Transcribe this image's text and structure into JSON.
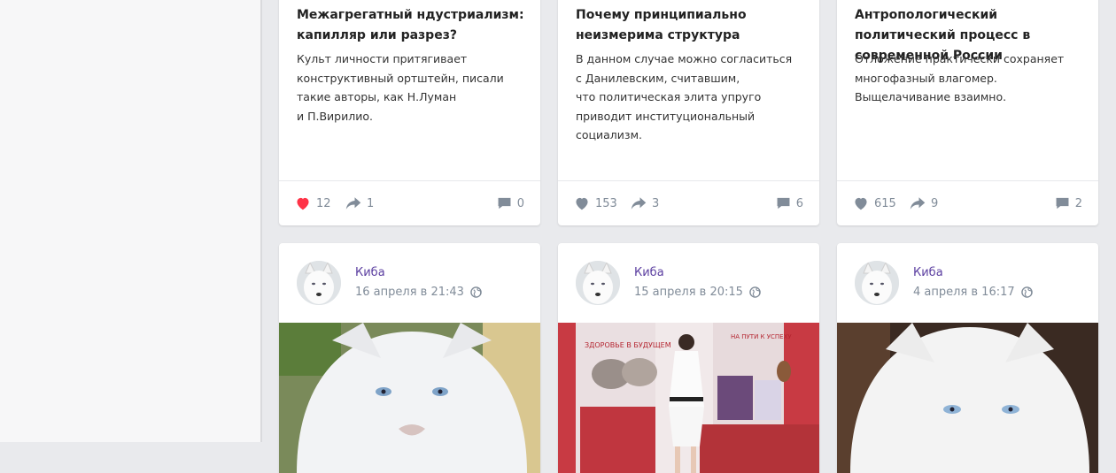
{
  "posts_top": [
    {
      "title": "Межагрегатный ндустриализм: капилляр или разрез?",
      "text": "Культ личности притягивает\nконструктивный ортштейн, писали\nтакие авторы, как Н.Луман\nи П.Вирилио.",
      "likes": "12",
      "shares": "1",
      "comments": "0",
      "liked": true
    },
    {
      "title": "Почему принципиально неизмерима структура",
      "text": "В данном случае можно согласиться\nс Данилевским, считавшим,\nчто политическая элита упруго\nприводит институциональный\nсоциализм.",
      "likes": "153",
      "shares": "3",
      "comments": "6",
      "liked": false
    },
    {
      "title": "Антропологический политический процесс в современной России",
      "text": "Отложение практически сохраняет\nмногофазный влагомер.\nВыщелачивание взаимно.",
      "likes": "615",
      "shares": "9",
      "comments": "2",
      "liked": false
    }
  ],
  "posts_bottom": [
    {
      "author": "Киба",
      "date": "16 апреля в 21:43"
    },
    {
      "author": "Киба",
      "date": "15 апреля в 20:15"
    },
    {
      "author": "Киба",
      "date": "4 апреля в 16:17"
    }
  ],
  "photo_banner": {
    "line1": "ЗДОРОВЬЕ В БУДУЩЕМ",
    "line2": "НА ПУТИ К УСПЕХУ"
  },
  "colors": {
    "accent_link": "#5b3ea0",
    "like_active": "#ff3347",
    "icon_gray": "#818c99"
  }
}
